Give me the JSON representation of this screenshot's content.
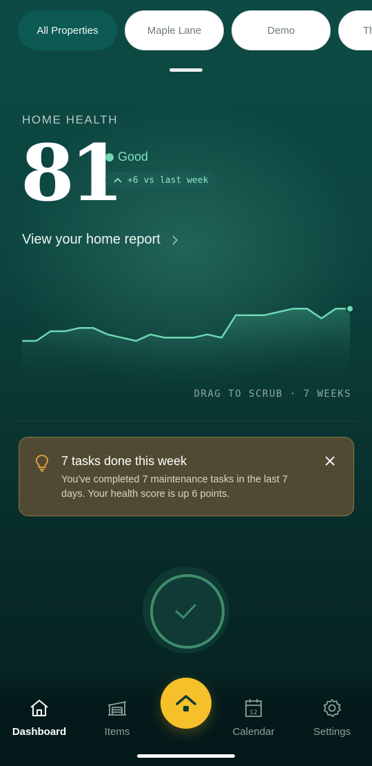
{
  "property_chips": [
    {
      "label": "All Properties",
      "active": true
    },
    {
      "label": "Maple Lane",
      "active": false
    },
    {
      "label": "Demo",
      "active": false
    },
    {
      "label": "Th",
      "active": false
    }
  ],
  "home_health": {
    "section_label": "HOME HEALTH",
    "score": "81",
    "status": "Good",
    "delta": "+6 vs last week",
    "report_link": "View your home report"
  },
  "chart_data": {
    "type": "area",
    "title": "",
    "x_range_label": "7 WEEKS",
    "values": [
      52,
      52,
      55,
      55,
      56,
      56,
      54,
      53,
      52,
      54,
      53,
      53,
      53,
      54,
      53,
      60,
      60,
      60,
      61,
      62,
      62,
      59,
      62,
      62
    ],
    "ylim": [
      40,
      70
    ],
    "grid": false,
    "hint": "DRAG TO SCRUB · 7 WEEKS",
    "line_color": "#6fd8b2"
  },
  "notice": {
    "title": "7 tasks done this week",
    "body": "You've completed 7 maintenance tasks in the last 7 days. Your health score is up 6 points.",
    "icon": "lightbulb-icon",
    "close_icon": "close-icon"
  },
  "complete_action": {
    "icon": "check-icon"
  },
  "tabbar": {
    "tabs": [
      {
        "label": "Dashboard",
        "icon": "home-icon",
        "active": true
      },
      {
        "label": "Items",
        "icon": "garage-icon",
        "active": false
      },
      {
        "label": "Calendar",
        "icon": "calendar-icon",
        "badge_text": "12",
        "active": false
      },
      {
        "label": "Settings",
        "icon": "gear-icon",
        "active": false
      }
    ],
    "fab_icon": "home-fab-icon"
  },
  "colors": {
    "accent_green": "#6fd8b2",
    "fab_yellow": "#f5c02a",
    "notice_bg": "#514a33"
  }
}
